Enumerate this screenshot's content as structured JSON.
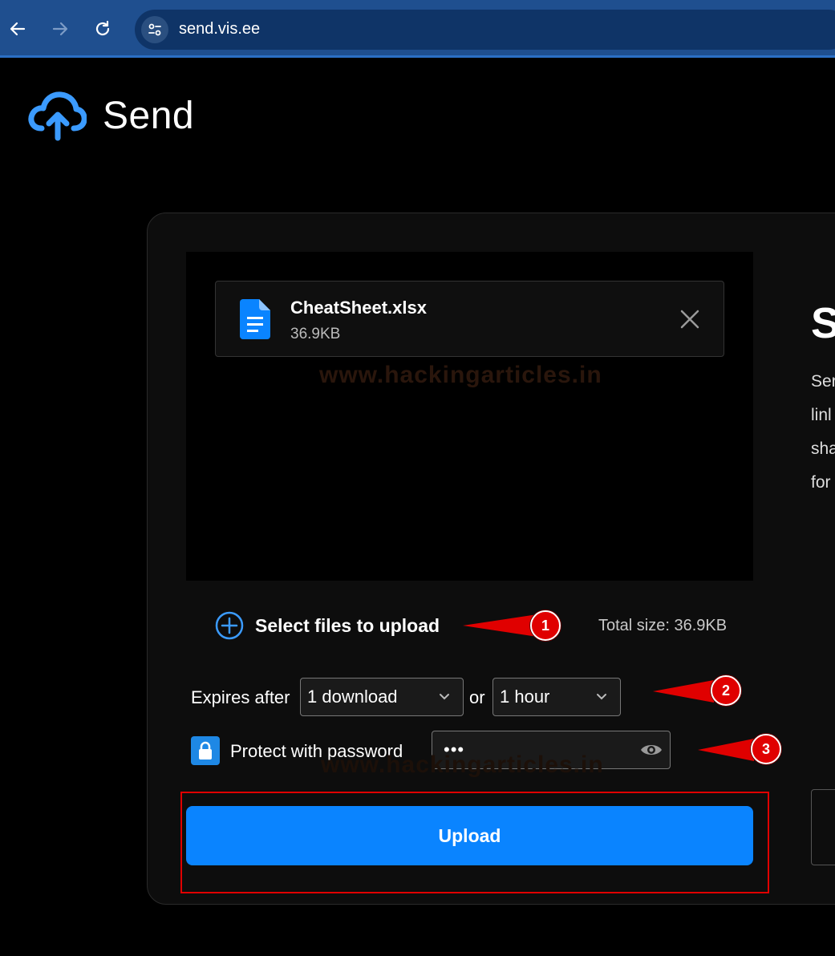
{
  "browser": {
    "url": "send.vis.ee"
  },
  "app": {
    "name": "Send"
  },
  "upload": {
    "file": {
      "name": "CheatSheet.xlsx",
      "size": "36.9KB"
    },
    "select_label": "Select files to upload",
    "total_size": "Total size: 36.9KB",
    "expires_label": "Expires after",
    "downloads_value": "1 download",
    "or_label": "or",
    "time_value": "1 hour",
    "password_label": "Protect with password",
    "password_value": "•••",
    "upload_label": "Upload"
  },
  "side": {
    "title": "Si",
    "lines": [
      "Ser",
      "linl",
      "sha",
      "for"
    ]
  },
  "watermark": "www.hackingarticles.in",
  "annotations": [
    "1",
    "2",
    "3"
  ],
  "colors": {
    "accent": "#0a84ff",
    "annotation": "#e00000"
  }
}
